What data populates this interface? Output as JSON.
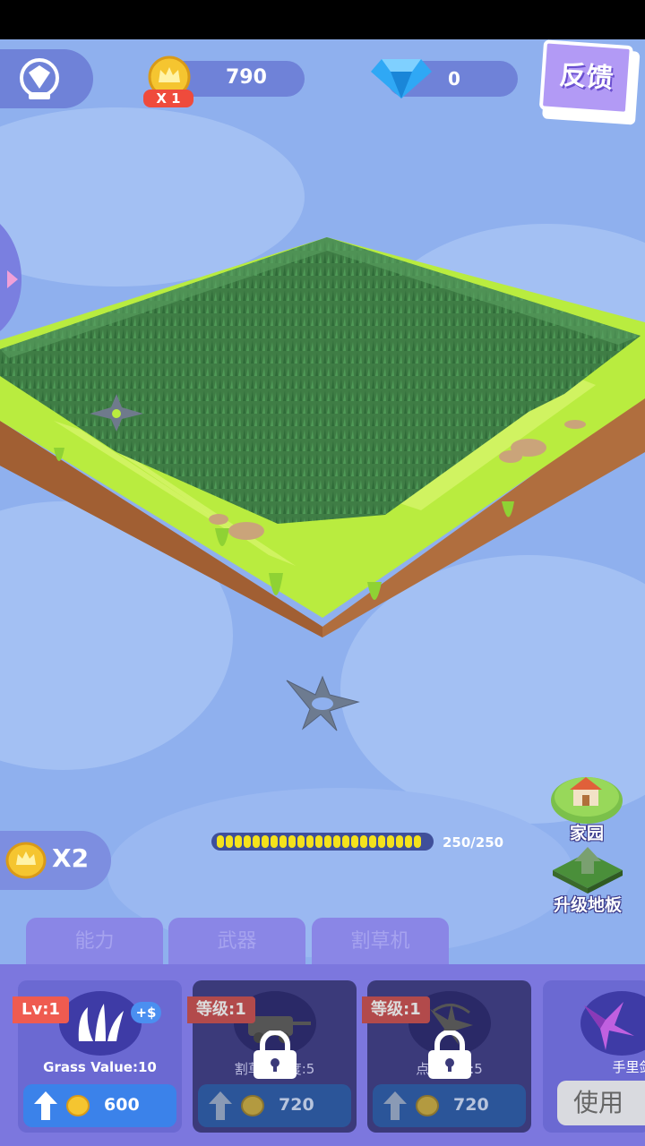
{
  "hud": {
    "coins": "790",
    "coin_multiplier": "X 1",
    "gems": "0",
    "feedback_label": "反馈"
  },
  "progress": {
    "text": "250/250",
    "fraction": 1.0
  },
  "side_buttons": {
    "home_label": "家园",
    "upgrade_land_label": "升级地板"
  },
  "boost": {
    "label": "X2"
  },
  "tabs": [
    {
      "label": "能力"
    },
    {
      "label": "武器"
    },
    {
      "label": "割草机"
    }
  ],
  "cards": [
    {
      "level": "Lv:1",
      "name": "Grass Value:10",
      "badge": "+$",
      "price": "600",
      "locked": false
    },
    {
      "level": "等级:1",
      "name": "割草机速度:5",
      "price": "720",
      "locked": true
    },
    {
      "level": "等级:1",
      "name": "点击速度:5",
      "price": "720",
      "locked": true
    },
    {
      "name": "手里剑",
      "action": "使用"
    }
  ],
  "colors": {
    "background": "#8fb0ee",
    "panel": "#7c77de",
    "grass": "#3f7d45",
    "lawn": "#b9ec3f",
    "coin": "#f5c530",
    "gem": "#2fa8f5"
  }
}
